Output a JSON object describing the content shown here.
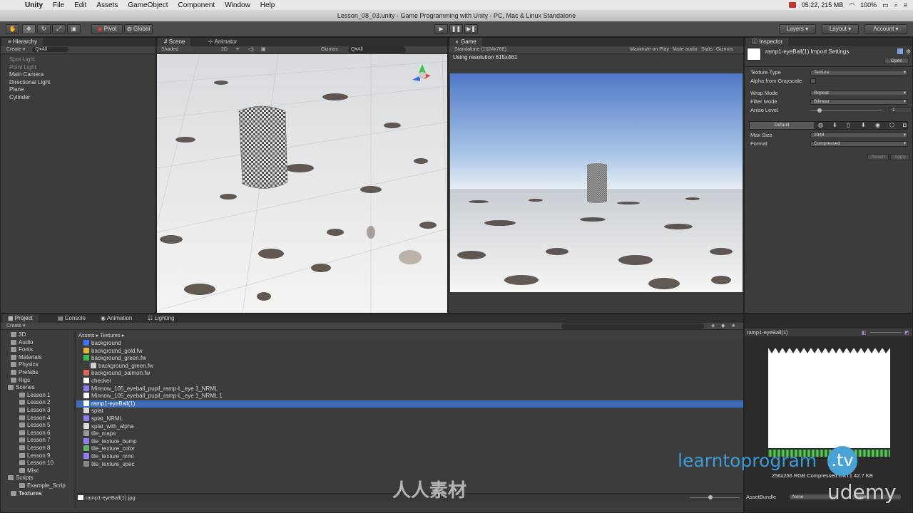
{
  "menubar": {
    "app": "Unity",
    "items": [
      "File",
      "Edit",
      "Assets",
      "GameObject",
      "Component",
      "Window",
      "Help"
    ],
    "status": "05:22, 215 MB",
    "battery": "100%"
  },
  "window_title": "Lesson_08_03.unity - Game Programming with Unity - PC, Mac & Linux Standalone",
  "toolbar": {
    "pivot": "Pivot",
    "global": "Global",
    "layers": "Layers",
    "layout": "Layout",
    "account": "Account"
  },
  "hierarchy": {
    "title": "Hierarchy",
    "create": "Create",
    "search": "Q▾All",
    "items": [
      "Spot Light",
      "Point Light",
      "Main Camera",
      "Directional Light",
      "Plane",
      "Cylinder"
    ]
  },
  "scene": {
    "tab": "Scene",
    "tab2": "Animator",
    "shaded": "Shaded",
    "mode2d": "2D",
    "gizmos": "Gizmos",
    "search": "Q▾All"
  },
  "game": {
    "tab": "Game",
    "resolution": "Standalone (1024x768)",
    "maximize": "Maximize on Play",
    "mute": "Mute audio",
    "stats": "Stats",
    "gizmos": "Gizmos",
    "using": "Using resolution 615x461"
  },
  "inspector": {
    "tab": "Inspector",
    "title": "ramp1-eyeBall(1) Import Settings",
    "open": "Open",
    "fields": [
      {
        "label": "Texture Type",
        "value": "Texture"
      },
      {
        "label": "Alpha from Grayscale",
        "value": ""
      },
      {
        "label": "Wrap Mode",
        "value": "Repeat"
      },
      {
        "label": "Filter Mode",
        "value": "Bilinear"
      },
      {
        "label": "Aniso Level",
        "value": "1"
      }
    ],
    "default_label": "Default",
    "max_size_label": "Max Size",
    "max_size": "2048",
    "format_label": "Format",
    "format": "Compressed",
    "revert": "Revert",
    "apply": "Apply"
  },
  "project": {
    "tabs": [
      "Project",
      "Console",
      "Animation",
      "Lighting"
    ],
    "create": "Create",
    "breadcrumb": [
      "Assets",
      "Textures"
    ],
    "folders": [
      {
        "name": "3D",
        "indent": 1
      },
      {
        "name": "Audio",
        "indent": 1
      },
      {
        "name": "Fonts",
        "indent": 1
      },
      {
        "name": "Materials",
        "indent": 1
      },
      {
        "name": "Physics",
        "indent": 1
      },
      {
        "name": "Prefabs",
        "indent": 1
      },
      {
        "name": "Rigs",
        "indent": 1
      },
      {
        "name": "Scenes",
        "indent": 1
      },
      {
        "name": "Lesson 1",
        "indent": 2
      },
      {
        "name": "Lesson 2",
        "indent": 2
      },
      {
        "name": "Lesson 3",
        "indent": 2
      },
      {
        "name": "Lesson 4",
        "indent": 2
      },
      {
        "name": "Lesson 5",
        "indent": 2
      },
      {
        "name": "Lesson 6",
        "indent": 2
      },
      {
        "name": "Lesson 7",
        "indent": 2
      },
      {
        "name": "Lesson 8",
        "indent": 2
      },
      {
        "name": "Lesson 9",
        "indent": 2
      },
      {
        "name": "Lesson 10",
        "indent": 2
      },
      {
        "name": "Misc",
        "indent": 2
      },
      {
        "name": "Scripts",
        "indent": 1
      },
      {
        "name": "Example_Scrip",
        "indent": 2
      },
      {
        "name": "Textures",
        "indent": 1
      }
    ],
    "assets": [
      {
        "name": "background",
        "color": "#3b78ff"
      },
      {
        "name": "background_gold.fw",
        "color": "#e2b23a"
      },
      {
        "name": "background_green.fw",
        "color": "#3dbd4a"
      },
      {
        "name": "background_green.fw",
        "color": "#cfcfcf",
        "child": true
      },
      {
        "name": "background_salmon.fw",
        "color": "#e06a5a"
      },
      {
        "name": "checker",
        "color": "#ffffff"
      },
      {
        "name": "Minnow_105_eyeball_pupil_ramp-L_eye 1_NRML",
        "color": "#8f7ef0"
      },
      {
        "name": "Minnow_105_eyeball_pupil_ramp-L_eye 1_NRML 1",
        "color": "#ffffff"
      },
      {
        "name": "ramp1-eyeBall(1)",
        "color": "#ffffff",
        "selected": true
      },
      {
        "name": "splat",
        "color": "#dddddd"
      },
      {
        "name": "splat_NRML",
        "color": "#8f7ef0"
      },
      {
        "name": "splat_with_alpha",
        "color": "#dddddd"
      },
      {
        "name": "tile_maps",
        "color": "#9a9a9a"
      },
      {
        "name": "tile_texture_bump",
        "color": "#8f7ef0"
      },
      {
        "name": "tile_texture_color",
        "color": "#5fb36a"
      },
      {
        "name": "tile_texture_nrml",
        "color": "#8f7ef0"
      },
      {
        "name": "tile_texture_spec",
        "color": "#888888"
      }
    ],
    "footer_file": "ramp1-eyeBall(1).jpg"
  },
  "preview": {
    "title": "ramp1-eyeBall(1)",
    "info": "256x256  RGB Compressed DXT1   42.7 KB",
    "assetbundle_label": "AssetBundle",
    "assetbundle_value": "None"
  },
  "watermark": {
    "learnto": "learntoprogram",
    "tv": ".tv",
    "udemy": "udemy",
    "cn": "人人素材"
  },
  "colors": {
    "selection": "#3e6bb5",
    "accent_blue": "#3b9bd8"
  }
}
